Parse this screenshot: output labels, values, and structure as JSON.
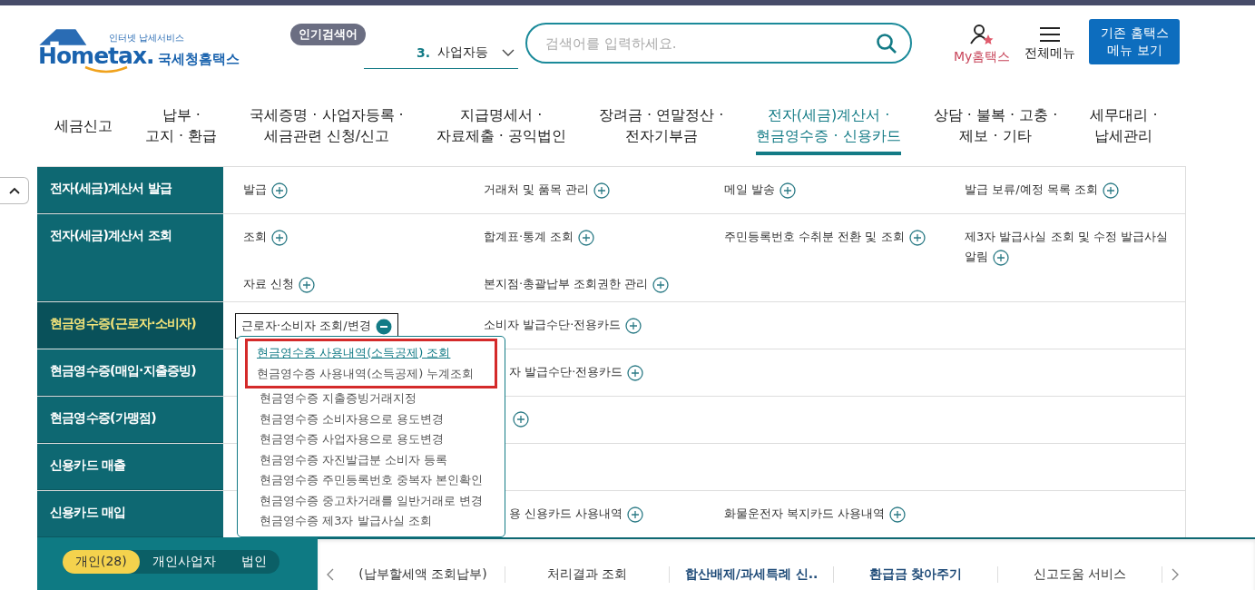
{
  "header": {
    "logo": {
      "tagline": "인터넷 납세서비스",
      "wordmark": "Hometax.",
      "site_name": "국세청홈택스"
    },
    "popular": {
      "label": "인기검색어",
      "rank": "3.",
      "term": "사업자등"
    },
    "search": {
      "placeholder": "검색어를 입력하세요."
    },
    "my_link": "My홈택스",
    "menu_link": "전체메뉴",
    "legacy_button": [
      "기존 홈택스",
      "메뉴 보기"
    ]
  },
  "nav": [
    {
      "lines": [
        "세금신고"
      ],
      "selected": false
    },
    {
      "lines": [
        "납부 ·",
        "고지 · 환급"
      ],
      "selected": false
    },
    {
      "lines": [
        "국세증명 · 사업자등록 ·",
        "세금관련 신청/신고"
      ],
      "selected": false
    },
    {
      "lines": [
        "지급명세서 ·",
        "자료제출 · 공익법인"
      ],
      "selected": false
    },
    {
      "lines": [
        "장려금 · 연말정산 ·",
        "전자기부금"
      ],
      "selected": false
    },
    {
      "lines": [
        "전자(세금)계산서 ·",
        "현금영수증 · 신용카드"
      ],
      "selected": true
    },
    {
      "lines": [
        "상담 · 불복 · 고충 ·",
        "제보 · 기타"
      ],
      "selected": false
    },
    {
      "lines": [
        "세무대리 ·",
        "납세관리"
      ],
      "selected": false
    }
  ],
  "mega_menu": {
    "sections": [
      {
        "title": "전자(세금)계산서 발급",
        "selected": false,
        "items": [
          {
            "kind": "link",
            "label": "발급",
            "expanded": false
          },
          {
            "kind": "link",
            "label": "거래처 및 품목 관리",
            "expanded": false
          },
          {
            "kind": "link",
            "label": "메일 발송",
            "expanded": false
          },
          {
            "kind": "link",
            "label": "발급 보류/예정 목록 조회",
            "expanded": false
          }
        ]
      },
      {
        "title": "전자(세금)계산서 조회",
        "selected": false,
        "items": [
          {
            "kind": "link",
            "label": "조회",
            "expanded": false
          },
          {
            "kind": "link",
            "label": "합계표·통계 조회",
            "expanded": false
          },
          {
            "kind": "link",
            "label": "주민등록번호 수취분 전환 및 조회",
            "expanded": false
          },
          {
            "kind": "link",
            "label": "제3자 발급사실 조회 및 수정 발급사실 알림",
            "expanded": false
          },
          {
            "kind": "link",
            "label": "자료 신청",
            "expanded": false
          },
          {
            "kind": "link",
            "label": "본지점·총괄납부 조회권한 관리",
            "expanded": false
          }
        ]
      },
      {
        "title": "현금영수증(근로자·소비자)",
        "selected": true,
        "items": [
          {
            "kind": "link",
            "label": "근로자·소비자 조회/변경",
            "expanded": true
          },
          {
            "kind": "link",
            "label": "소비자 발급수단·전용카드",
            "expanded": false
          }
        ]
      },
      {
        "title": "현금영수증(매입·지출증빙)",
        "selected": false,
        "items": [
          {
            "kind": "covered",
            "label": "자 발급수단·전용카드",
            "expanded": false
          }
        ]
      },
      {
        "title": "현금영수증(가맹점)",
        "selected": false,
        "items": [
          {
            "kind": "icon-only",
            "expanded": false
          }
        ]
      },
      {
        "title": "신용카드 매출",
        "selected": false
      },
      {
        "title": "신용카드 매입",
        "selected": false,
        "items": [
          {
            "kind": "covered",
            "label": "용 신용카드 사용내역",
            "expanded": false
          },
          {
            "kind": "link",
            "label": "화물운전자 복지카드 사용내역",
            "expanded": false
          }
        ]
      }
    ]
  },
  "submenu": {
    "items": [
      {
        "label": "현금영수증 사용내역(소득공제) 조회",
        "selected": true,
        "highlighted": true
      },
      {
        "label": "현금영수증 사용내역(소득공제) 누계조회",
        "selected": false,
        "highlighted": true
      },
      {
        "label": "현금영수증 지출증빙거래지정",
        "selected": false,
        "highlighted": false
      },
      {
        "label": "현금영수증 소비자용으로 용도변경",
        "selected": false,
        "highlighted": false
      },
      {
        "label": "현금영수증 사업자용으로 용도변경",
        "selected": false,
        "highlighted": false
      },
      {
        "label": "현금영수증 자진발급분 소비자 등록",
        "selected": false,
        "highlighted": false
      },
      {
        "label": "현금영수증 주민등록번호 중복자 본인확인",
        "selected": false,
        "highlighted": false
      },
      {
        "label": "현금영수증 중고차거래를 일반거래로 변경",
        "selected": false,
        "highlighted": false
      },
      {
        "label": "현금영수증 제3자 발급사실 조회",
        "selected": false,
        "highlighted": false
      }
    ]
  },
  "bottom": {
    "tabs": [
      {
        "label": "개인(28)",
        "selected": true
      },
      {
        "label": "개인사업자",
        "selected": false
      },
      {
        "label": "법인",
        "selected": false
      }
    ],
    "cards": [
      {
        "label": "(납부할세액 조회납부)",
        "emphasis": false
      },
      {
        "label": "처리결과 조회",
        "emphasis": false
      },
      {
        "label": "합산배제/과세특례 신..",
        "emphasis": true
      },
      {
        "label": "환급금 찾아주기",
        "emphasis": true
      },
      {
        "label": "신고도움 서비스",
        "emphasis": false
      }
    ]
  }
}
